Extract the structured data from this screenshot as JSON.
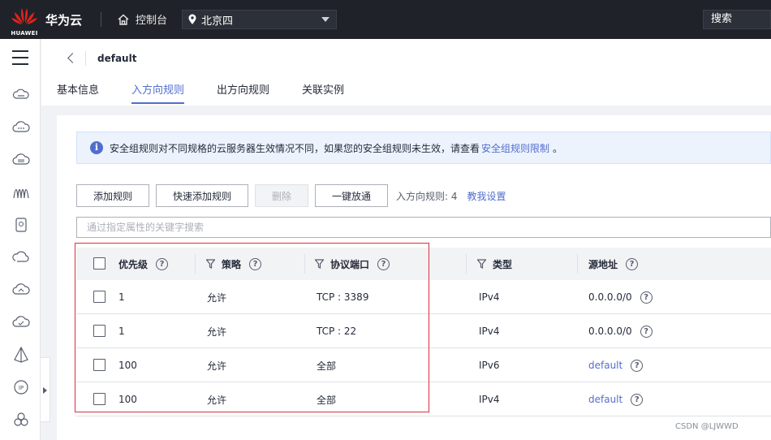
{
  "topbar": {
    "brand": "华为云",
    "logo_text": "HUAWEI",
    "console": "控制台",
    "region": "北京四",
    "search": "搜索"
  },
  "header": {
    "title": "default",
    "tabs": [
      {
        "label": "基本信息",
        "active": false
      },
      {
        "label": "入方向规则",
        "active": true
      },
      {
        "label": "出方向规则",
        "active": false
      },
      {
        "label": "关联实例",
        "active": false
      }
    ]
  },
  "alert": {
    "text": "安全组规则对不同规格的云服务器生效情况不同，如果您的安全组规则未生效，请查看",
    "link": "安全组规则限制",
    "suffix": "。"
  },
  "toolbar": {
    "add": "添加规则",
    "quick_add": "快速添加规则",
    "delete": "删除",
    "one_click": "一键放通",
    "count_label": "入方向规则: 4",
    "help_link": "教我设置"
  },
  "filter": {
    "placeholder": "通过指定属性的关键字搜索"
  },
  "table": {
    "columns": {
      "priority": "优先级",
      "policy": "策略",
      "protocol": "协议端口",
      "type": "类型",
      "source": "源地址"
    },
    "rows": [
      {
        "priority": "1",
        "policy": "允许",
        "protocol": "TCP : 3389",
        "type": "IPv4",
        "source": "0.0.0.0/0"
      },
      {
        "priority": "1",
        "policy": "允许",
        "protocol": "TCP : 22",
        "type": "IPv4",
        "source": "0.0.0.0/0"
      },
      {
        "priority": "100",
        "policy": "允许",
        "protocol": "全部",
        "type": "IPv6",
        "source": "default"
      },
      {
        "priority": "100",
        "policy": "允许",
        "protocol": "全部",
        "type": "IPv4",
        "source": "default"
      }
    ]
  },
  "watermark": "CSDN @LJWWD",
  "colors": {
    "topbar": "#1f2329",
    "accent": "#526ecc",
    "highlight": "#d9303e"
  }
}
